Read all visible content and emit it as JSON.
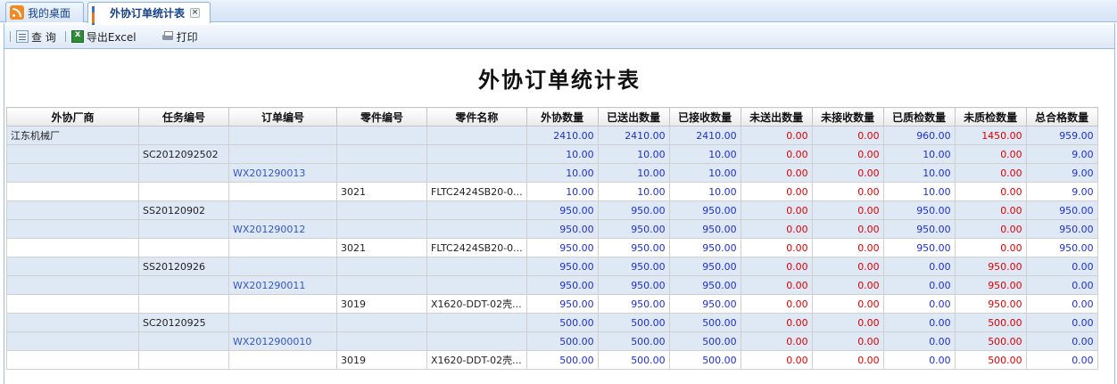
{
  "tabs": [
    {
      "label": "我的桌面",
      "icon": "rss-icon",
      "active": false
    },
    {
      "label": "外协订单统计表",
      "icon": "bar-chart-icon",
      "active": true
    }
  ],
  "toolbar": {
    "query_label": "查 询",
    "export_label": "导出Excel",
    "print_label": "打印"
  },
  "report_title": "外协订单统计表",
  "table": {
    "headers": [
      "外协厂商",
      "任务编号",
      "订单编号",
      "零件编号",
      "零件名称",
      "外协数量",
      "已送出数量",
      "已接收数量",
      "未送出数量",
      "未接收数量",
      "已质检数量",
      "未质检数量",
      "总合格数量"
    ],
    "rows": [
      {
        "cells": [
          "江东机械厂",
          "",
          "",
          "",
          "",
          "2410.00",
          "2410.00",
          "2410.00",
          "0.00",
          "0.00",
          "960.00",
          "1450.00",
          "959.00"
        ],
        "shade": "blue"
      },
      {
        "cells": [
          "",
          "SC2012092502",
          "",
          "",
          "",
          "10.00",
          "10.00",
          "10.00",
          "0.00",
          "0.00",
          "10.00",
          "0.00",
          "9.00"
        ],
        "shade": "blue"
      },
      {
        "cells": [
          "",
          "",
          "WX201290013",
          "",
          "",
          "10.00",
          "10.00",
          "10.00",
          "0.00",
          "0.00",
          "10.00",
          "0.00",
          "9.00"
        ],
        "shade": "blue"
      },
      {
        "cells": [
          "",
          "",
          "",
          "3021",
          "FLTC2424SB20-0...",
          "10.00",
          "10.00",
          "10.00",
          "0.00",
          "0.00",
          "10.00",
          "0.00",
          "9.00"
        ],
        "shade": "white"
      },
      {
        "cells": [
          "",
          "SS20120902",
          "",
          "",
          "",
          "950.00",
          "950.00",
          "950.00",
          "0.00",
          "0.00",
          "950.00",
          "0.00",
          "950.00"
        ],
        "shade": "blue"
      },
      {
        "cells": [
          "",
          "",
          "WX201290012",
          "",
          "",
          "950.00",
          "950.00",
          "950.00",
          "0.00",
          "0.00",
          "950.00",
          "0.00",
          "950.00"
        ],
        "shade": "blue"
      },
      {
        "cells": [
          "",
          "",
          "",
          "3021",
          "FLTC2424SB20-0...",
          "950.00",
          "950.00",
          "950.00",
          "0.00",
          "0.00",
          "950.00",
          "0.00",
          "950.00"
        ],
        "shade": "white"
      },
      {
        "cells": [
          "",
          "SS20120926",
          "",
          "",
          "",
          "950.00",
          "950.00",
          "950.00",
          "0.00",
          "0.00",
          "0.00",
          "950.00",
          "0.00"
        ],
        "shade": "blue"
      },
      {
        "cells": [
          "",
          "",
          "WX201290011",
          "",
          "",
          "950.00",
          "950.00",
          "950.00",
          "0.00",
          "0.00",
          "0.00",
          "950.00",
          "0.00"
        ],
        "shade": "blue"
      },
      {
        "cells": [
          "",
          "",
          "",
          "3019",
          "X1620-DDT-02壳...",
          "950.00",
          "950.00",
          "950.00",
          "0.00",
          "0.00",
          "0.00",
          "950.00",
          "0.00"
        ],
        "shade": "white"
      },
      {
        "cells": [
          "",
          "SC20120925",
          "",
          "",
          "",
          "500.00",
          "500.00",
          "500.00",
          "0.00",
          "0.00",
          "0.00",
          "500.00",
          "0.00"
        ],
        "shade": "blue"
      },
      {
        "cells": [
          "",
          "",
          "WX2012900010",
          "",
          "",
          "500.00",
          "500.00",
          "500.00",
          "0.00",
          "0.00",
          "0.00",
          "500.00",
          "0.00"
        ],
        "shade": "blue"
      },
      {
        "cells": [
          "",
          "",
          "",
          "3019",
          "X1620-DDT-02壳...",
          "500.00",
          "500.00",
          "500.00",
          "0.00",
          "0.00",
          "0.00",
          "500.00",
          "0.00"
        ],
        "shade": "white"
      }
    ]
  },
  "colors": {
    "number_blue": "#1f2fd2",
    "number_red": "#e00000",
    "link_blue": "#3355cc",
    "row_shade": "#dfe9f6"
  }
}
